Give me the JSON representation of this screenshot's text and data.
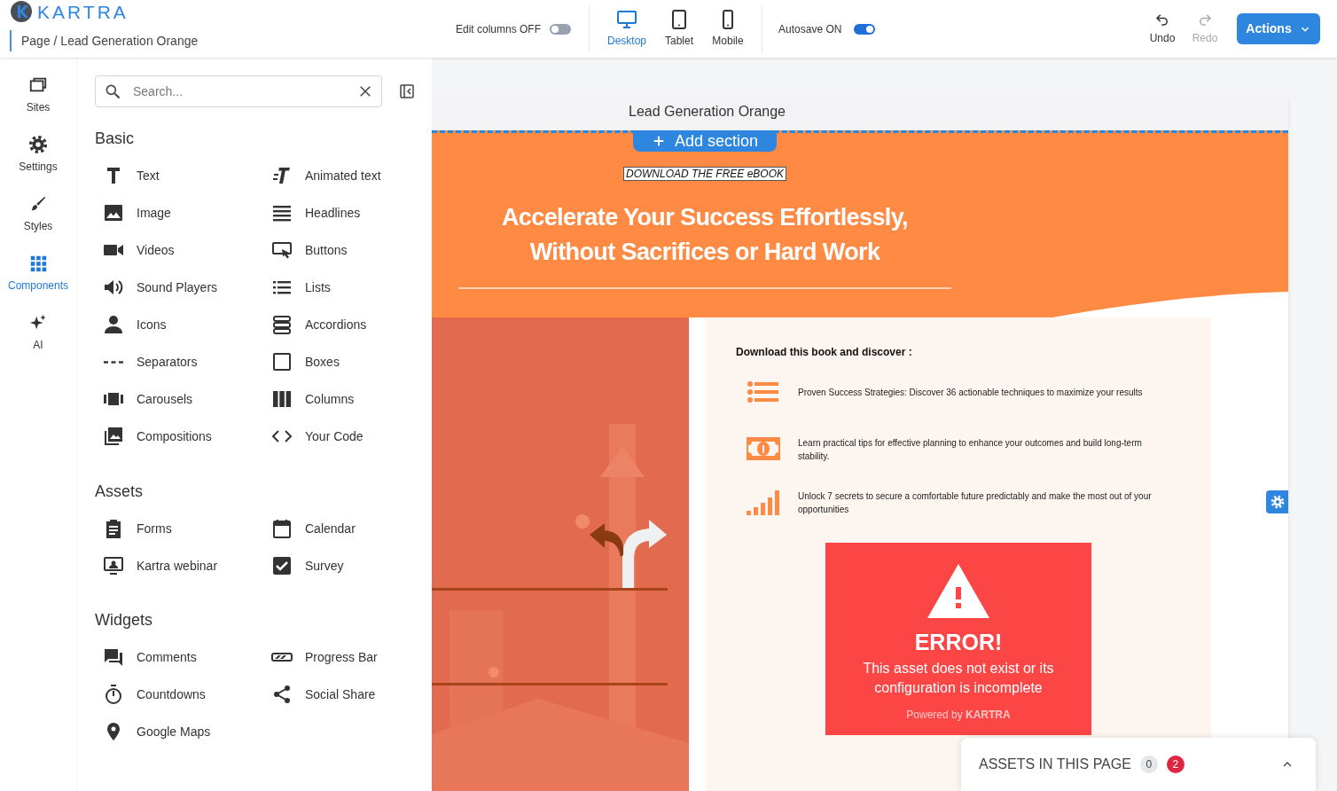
{
  "logo_text": "KARTRA",
  "breadcrumb": "Page / Lead Generation Orange",
  "edit_columns": {
    "label": "Edit columns OFF",
    "on": false
  },
  "devices": [
    {
      "label": "Desktop",
      "selected": true
    },
    {
      "label": "Tablet",
      "selected": false
    },
    {
      "label": "Mobile",
      "selected": false
    }
  ],
  "autosave": {
    "label": "Autosave ON",
    "on": true
  },
  "history": [
    {
      "label": "Undo",
      "disabled": false
    },
    {
      "label": "Redo",
      "disabled": true
    }
  ],
  "actions_button": "Actions",
  "rail": [
    {
      "label": "Sites",
      "selected": false
    },
    {
      "label": "Settings",
      "selected": false
    },
    {
      "label": "Styles",
      "selected": false
    },
    {
      "label": "Components",
      "selected": true
    },
    {
      "label": "AI",
      "selected": false
    }
  ],
  "search": {
    "placeholder": "Search..."
  },
  "sections": [
    {
      "title": "Basic",
      "items": [
        "Text",
        "Animated text",
        "Image",
        "Headlines",
        "Videos",
        "Buttons",
        "Sound Players",
        "Lists",
        "Icons",
        "Accordions",
        "Separators",
        "Boxes",
        "Carousels",
        "Columns",
        "Compositions",
        "Your Code"
      ]
    },
    {
      "title": "Assets",
      "items": [
        "Forms",
        "Calendar",
        "Kartra webinar",
        "Survey"
      ]
    },
    {
      "title": "Widgets",
      "items": [
        "Comments",
        "Progress Bar",
        "Countdowns",
        "Social Share",
        "Google Maps"
      ]
    }
  ],
  "page": {
    "title": "Lead Generation Orange",
    "add_section": "Add section",
    "eyebrow": "DOWNLOAD THE FREE eBOOK",
    "headline": [
      "Accelerate Your Success Effortlessly,",
      "Without Sacrifices or Hard Work"
    ],
    "cover": {
      "kind": "picture"
    },
    "discover_heading": "Download this book and discover :",
    "features": [
      "Proven Success Strategies: Discover 36 actionable techniques to maximize your results",
      "Learn practical tips for effective planning to enhance your outcomes and build long-term stability.",
      "Unlock 7 secrets to secure a comfortable future predictably and make the most out of your opportunities"
    ],
    "error": {
      "title": "ERROR!",
      "message": "This asset does not exist or its configuration is incomplete",
      "powered_by": "Powered by **KARTRA**"
    }
  },
  "assets_panel": {
    "title": "ASSETS IN THIS PAGE",
    "count_ok": "0",
    "count_errors": "2"
  }
}
